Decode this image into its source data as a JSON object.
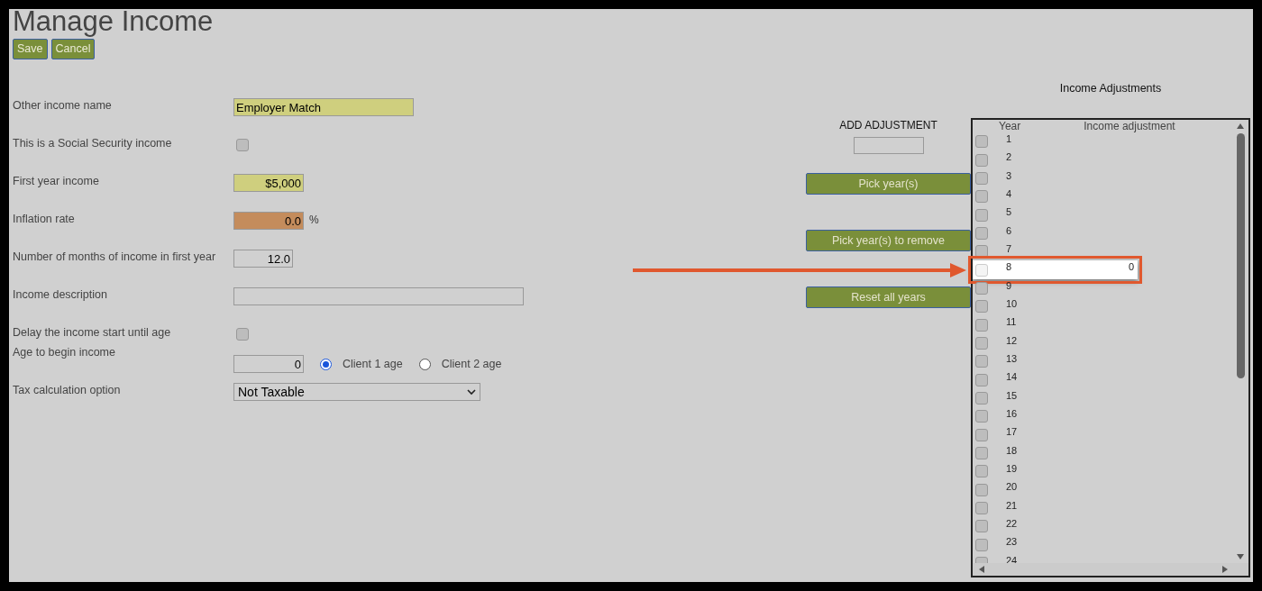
{
  "page": {
    "title": "Manage Income"
  },
  "actions": [
    {
      "label": "Save"
    },
    {
      "label": "Cancel"
    }
  ],
  "form": [
    {
      "kind": "text",
      "label": "Other income name",
      "value": "Employer Match"
    },
    {
      "kind": "checkbox",
      "label": "This is a Social Security income",
      "checked": false
    },
    {
      "kind": "amount",
      "label": "First year income",
      "value": "$5,000"
    },
    {
      "kind": "percent",
      "label": "Inflation rate",
      "value": "0.0",
      "unit": "%"
    },
    {
      "kind": "number",
      "label": "Number of months of income in first year",
      "value": "12.0"
    },
    {
      "kind": "wide-text",
      "label": "Income description"
    },
    {
      "kind": "checkbox",
      "label": "Delay the income start until age",
      "checked": false
    },
    {
      "kind": "age",
      "label": "Age to begin income",
      "value": "0",
      "options": [
        {
          "label": "Client 1 age",
          "selected": true
        },
        {
          "label": "Client 2 age",
          "selected": false
        }
      ]
    },
    {
      "kind": "select",
      "label": "Tax calculation option",
      "value": "Not Taxable"
    }
  ],
  "add_adjustment": {
    "label": "ADD ADJUSTMENT",
    "buttons": [
      {
        "label": "Pick year(s)"
      },
      {
        "label": "Pick year(s) to remove"
      },
      {
        "label": "Reset all years"
      }
    ]
  },
  "adjustments": {
    "title": "Income Adjustments",
    "columns": [
      "Year",
      "Income adjustment"
    ],
    "rows": [
      {
        "year": "1",
        "checked": false,
        "selected": false
      },
      {
        "year": "2",
        "checked": false,
        "selected": false
      },
      {
        "year": "3",
        "checked": false,
        "selected": false
      },
      {
        "year": "4",
        "checked": false,
        "selected": false
      },
      {
        "year": "5",
        "checked": false,
        "selected": false
      },
      {
        "year": "6",
        "checked": false,
        "selected": false
      },
      {
        "year": "7",
        "checked": false,
        "selected": false
      },
      {
        "year": "8",
        "adjustment": "0",
        "checked": false,
        "selected": true
      },
      {
        "year": "9",
        "checked": false,
        "selected": false
      },
      {
        "year": "10",
        "checked": false,
        "selected": false
      },
      {
        "year": "11",
        "checked": false,
        "selected": false
      },
      {
        "year": "12",
        "checked": false,
        "selected": false
      },
      {
        "year": "13",
        "checked": false,
        "selected": false
      },
      {
        "year": "14",
        "checked": false,
        "selected": false
      },
      {
        "year": "15",
        "checked": false,
        "selected": false
      },
      {
        "year": "16",
        "checked": false,
        "selected": false
      },
      {
        "year": "17",
        "checked": false,
        "selected": false
      },
      {
        "year": "18",
        "checked": false,
        "selected": false
      },
      {
        "year": "19",
        "checked": false,
        "selected": false
      },
      {
        "year": "20",
        "checked": false,
        "selected": false
      },
      {
        "year": "21",
        "checked": false,
        "selected": false
      },
      {
        "year": "22",
        "checked": false,
        "selected": false
      },
      {
        "year": "23",
        "checked": false,
        "selected": false
      },
      {
        "year": "24",
        "checked": false,
        "selected": false
      }
    ]
  }
}
